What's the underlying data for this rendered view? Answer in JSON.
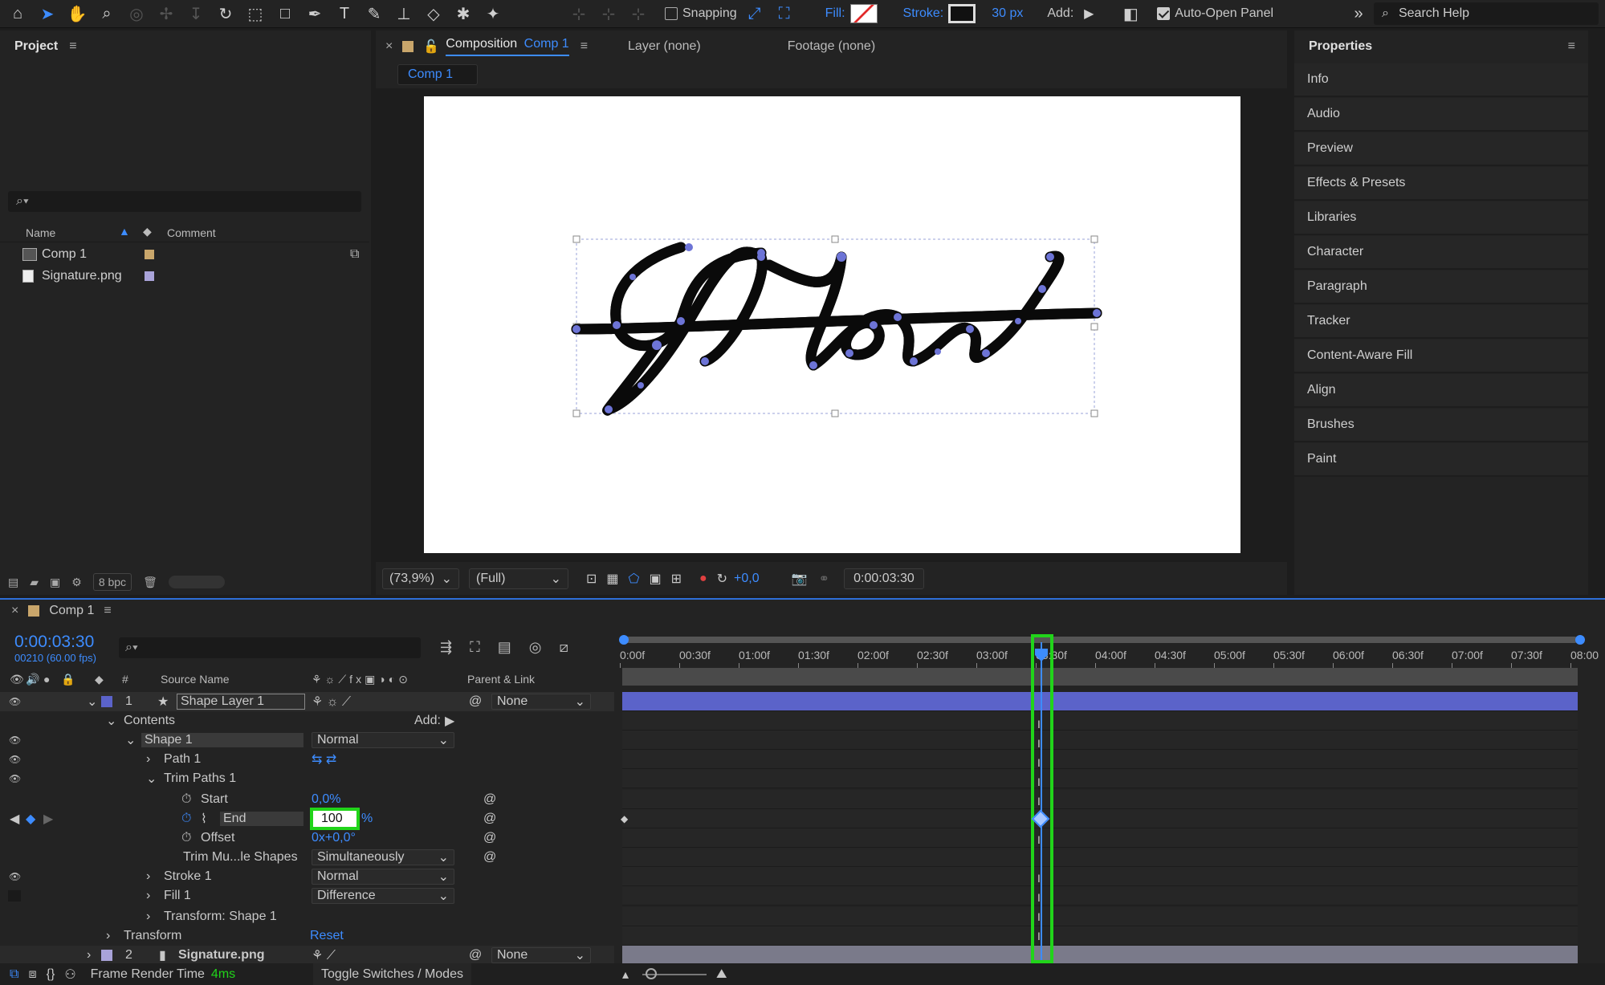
{
  "toolbar": {
    "snapping_label": "Snapping",
    "fill_label": "Fill:",
    "stroke_label": "Stroke:",
    "stroke_width": "30 px",
    "add_label": "Add:",
    "auto_open_label": "Auto-Open Panel",
    "search_placeholder": "Search Help",
    "stroke_color": "#111111",
    "accent": "#3d8cff"
  },
  "project": {
    "title": "Project",
    "col_name": "Name",
    "col_comment": "Comment",
    "items": [
      {
        "name": "Comp 1",
        "label_color": "#c9a66b"
      },
      {
        "name": "Signature.png",
        "label_color": "#a9a3d9"
      }
    ],
    "bpc": "8 bpc"
  },
  "composition": {
    "tab_label": "Composition",
    "tab_comp": "Comp 1",
    "layer_tab": "Layer (none)",
    "footage_tab": "Footage (none)",
    "subtab": "Comp 1",
    "zoom": "(73,9%)",
    "resolution": "(Full)",
    "exposure": "+0,0",
    "timecode": "0:00:03:30"
  },
  "properties": {
    "title": "Properties",
    "items": [
      "Info",
      "Audio",
      "Preview",
      "Effects & Presets",
      "Libraries",
      "Character",
      "Paragraph",
      "Tracker",
      "Content-Aware Fill",
      "Align",
      "Brushes",
      "Paint"
    ]
  },
  "timeline": {
    "comp_name": "Comp 1",
    "timecode": "0:00:03:30",
    "frames": "00210 (60.00 fps)",
    "col_num": "#",
    "col_source": "Source Name",
    "col_parent": "Parent & Link",
    "ticks": [
      "0:00f",
      "00:30f",
      "01:00f",
      "01:30f",
      "02:00f",
      "02:30f",
      "03:00f",
      "03:30f",
      "04:00f",
      "04:30f",
      "05:00f",
      "05:30f",
      "06:00f",
      "06:30f",
      "07:00f",
      "07:30f",
      "08:00"
    ],
    "layer1": {
      "num": "1",
      "name": "Shape Layer 1",
      "parent": "None"
    },
    "contents": "Contents",
    "add_label": "Add:",
    "shape1": "Shape 1",
    "shape1_mode": "Normal",
    "path1": "Path 1",
    "trim": "Trim Paths 1",
    "start_label": "Start",
    "start_val": "0,0%",
    "end_label": "End",
    "end_val": "100",
    "end_unit": "%",
    "offset_label": "Offset",
    "offset_val": "0x+0,0°",
    "trim_multi_label": "Trim Mu...le Shapes",
    "trim_multi_val": "Simultaneously",
    "stroke1": "Stroke 1",
    "stroke1_mode": "Normal",
    "fill1": "Fill 1",
    "fill1_mode": "Difference",
    "transform_shape": "Transform: Shape 1",
    "transform": "Transform",
    "reset": "Reset",
    "layer2": {
      "num": "2",
      "name": "Signature.png",
      "parent": "None"
    },
    "frame_render_label": "Frame Render Time",
    "frame_render_val": "4ms",
    "toggle_label": "Toggle Switches / Modes",
    "layer_color": "#5b63c9",
    "highlight": "#21d41a"
  }
}
